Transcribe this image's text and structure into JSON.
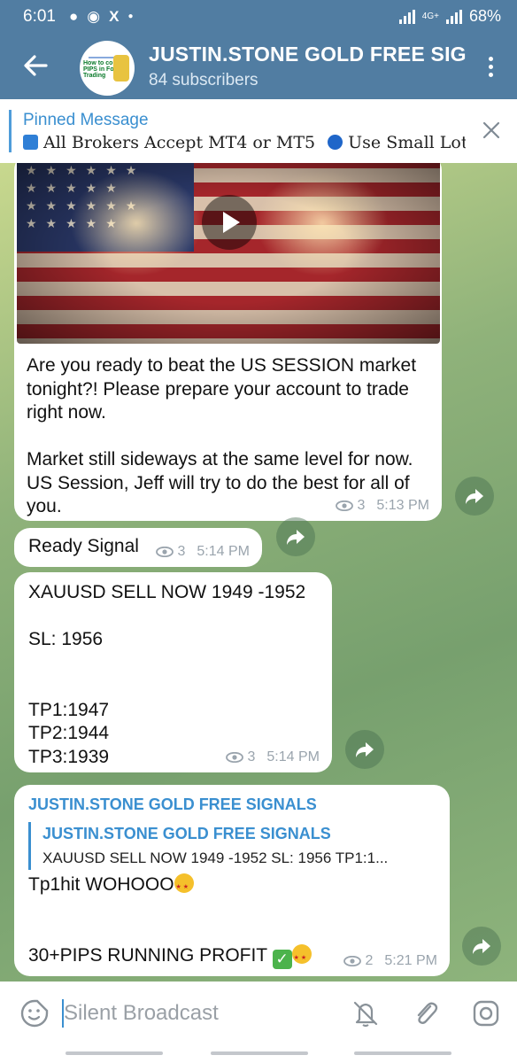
{
  "status_bar": {
    "time": "6:01",
    "battery": "68%",
    "network": "4G+"
  },
  "header": {
    "back_label": "Back",
    "title": "JUSTIN.STONE GOLD FREE SIGNALS",
    "subtitle": "84 subscribers",
    "avatar_text": "How to count PIPS in Forex Trading"
  },
  "pinned": {
    "title": "Pinned Message",
    "text_part1": "All Brokers Accept MT4 or MT5",
    "text_part2": "Use Small Lots..."
  },
  "messages": [
    {
      "text": "Are you ready to beat the US SESSION market tonight?! Please prepare your account to trade right now.\n\nMarket still sideways at the same level for now. US Session, Jeff will try to do the best for all of you.",
      "views": "3",
      "time": "5:13 PM"
    },
    {
      "text": "Ready Signal",
      "views": "3",
      "time": "5:14 PM"
    },
    {
      "text": "XAUUSD SELL NOW 1949 -1952\n\nSL: 1956\n\n\nTP1:1947\nTP2:1944\nTP3:1939",
      "views": "3",
      "time": "5:14 PM"
    },
    {
      "sender": "JUSTIN.STONE GOLD FREE SIGNALS",
      "reply_name": "JUSTIN.STONE GOLD FREE SIGNALS",
      "reply_text": "XAUUSD SELL NOW 1949 -1952  SL: 1956   TP1:1...",
      "line1": "Tp1hit WOHOOO",
      "line2": "30+PIPS RUNNING PROFIT ",
      "views": "2",
      "time": "5:21 PM"
    }
  ],
  "input": {
    "placeholder": "Silent Broadcast"
  },
  "colors": {
    "header": "#517da2",
    "accent": "#3a8fd0",
    "bubble": "#ffffff"
  }
}
